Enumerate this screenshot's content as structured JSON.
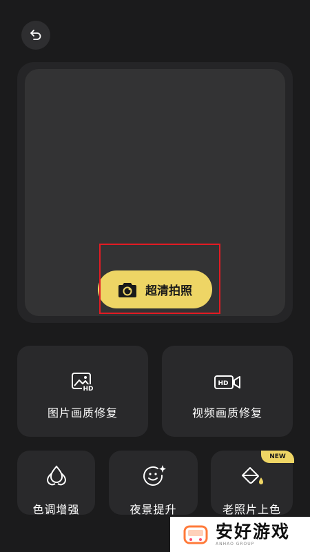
{
  "back_icon": "undo-arrow-icon",
  "shoot_button": {
    "label": "超清拍照",
    "icon": "camera-icon"
  },
  "features": {
    "large": [
      {
        "label": "图片画质修复",
        "icon": "image-hd-icon"
      },
      {
        "label": "视频画质修复",
        "icon": "video-hd-icon"
      }
    ],
    "small": [
      {
        "label": "色调增强",
        "icon": "drops-icon"
      },
      {
        "label": "夜景提升",
        "icon": "smile-sparkle-icon"
      },
      {
        "label": "老照片上色",
        "icon": "paint-bucket-icon",
        "badge": "NEW"
      }
    ]
  },
  "watermark": {
    "title": "安好游戏",
    "subtitle": "ANHAO GROUP"
  },
  "colors": {
    "accent": "#eed565",
    "background": "#1b1b1c",
    "card": "#29292b",
    "highlight": "#e31b23"
  }
}
